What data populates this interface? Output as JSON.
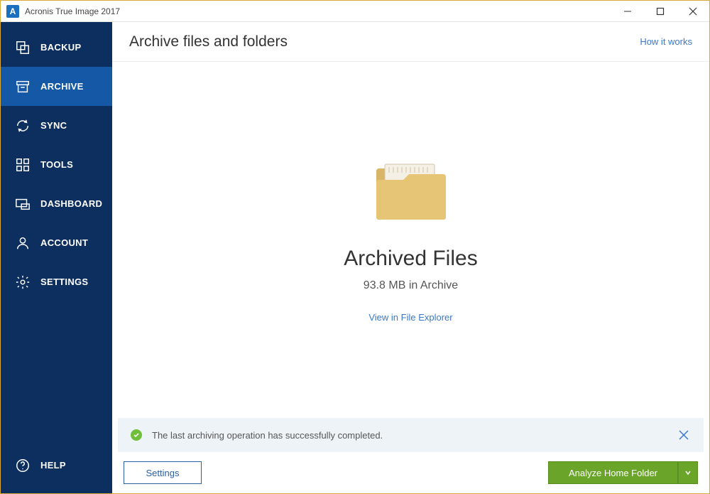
{
  "window": {
    "title": "Acronis True Image 2017"
  },
  "sidebar": {
    "items": [
      {
        "label": "BACKUP"
      },
      {
        "label": "ARCHIVE"
      },
      {
        "label": "SYNC"
      },
      {
        "label": "TOOLS"
      },
      {
        "label": "DASHBOARD"
      },
      {
        "label": "ACCOUNT"
      },
      {
        "label": "SETTINGS"
      }
    ],
    "help": "HELP"
  },
  "header": {
    "title": "Archive files and folders",
    "how_link": "How it works"
  },
  "archive": {
    "heading": "Archived Files",
    "sub": "93.8 MB in Archive",
    "view_link": "View in File Explorer"
  },
  "status": {
    "text": "The last archiving operation has successfully completed."
  },
  "bottom": {
    "settings": "Settings",
    "analyze": "Analyze Home Folder"
  }
}
